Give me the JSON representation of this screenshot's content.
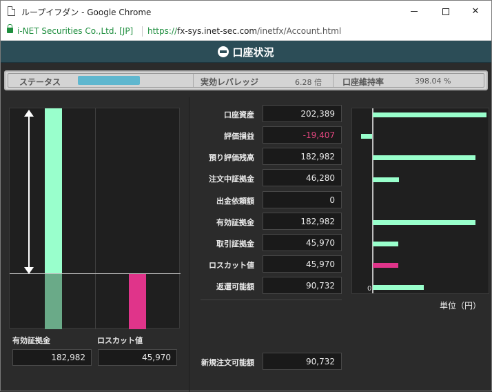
{
  "window": {
    "title": "ループイフダン - Google Chrome",
    "minimize_glyph": "",
    "maximize_glyph": "",
    "close_glyph": "✕"
  },
  "address": {
    "company": "i-NET Securities Co.,Ltd. [JP]",
    "url_scheme": "https://",
    "url_host": "fx-sys.inet-sec.com",
    "url_path": "/inetfx/Account.html"
  },
  "header": {
    "title": "口座状況"
  },
  "status": {
    "status_label": "ステータス",
    "status_level_fraction": 0.75,
    "leverage_label": "実効レバレッジ",
    "leverage_value": "6.28 倍",
    "maintenance_label": "口座維持率",
    "maintenance_value": "398.04 %"
  },
  "colors": {
    "mint": "#99ffcc",
    "mint_dark": "#6aaa88",
    "magenta": "#e0348a",
    "negative_text": "#e0467e",
    "header_bg": "#2c4d57"
  },
  "gauge": {
    "effective_margin_label": "有効証拠金",
    "effective_margin_value": "182,982",
    "losscut_label": "ロスカット値",
    "losscut_value": "45,970"
  },
  "table": {
    "rows": [
      {
        "label": "口座資産",
        "value": "202,389",
        "negative": false
      },
      {
        "label": "評価損益",
        "value": "-19,407",
        "negative": true
      },
      {
        "label": "預り評価残高",
        "value": "182,982",
        "negative": false
      },
      {
        "label": "注文中証拠金",
        "value": "46,280",
        "negative": false
      },
      {
        "label": "出金依頼額",
        "value": "0",
        "negative": false
      },
      {
        "label": "有効証拠金",
        "value": "182,982",
        "negative": false
      },
      {
        "label": "取引証拠金",
        "value": "45,970",
        "negative": false
      },
      {
        "label": "ロスカット値",
        "value": "45,970",
        "negative": false
      },
      {
        "label": "返還可能額",
        "value": "90,732",
        "negative": false
      }
    ],
    "new_order_label": "新規注文可能額",
    "new_order_value": "90,732"
  },
  "chart_data": {
    "type": "bar",
    "orientation": "horizontal",
    "categories": [
      "口座資産",
      "評価損益",
      "預り評価残高",
      "注文中証拠金",
      "出金依頼額",
      "有効証拠金",
      "取引証拠金",
      "ロスカット値",
      "返還可能額"
    ],
    "values": [
      202389,
      -19407,
      182982,
      46280,
      0,
      182982,
      45970,
      45970,
      90732
    ],
    "highlight_index": 7,
    "zero_label": "0",
    "unit_label": "単位（円）"
  }
}
